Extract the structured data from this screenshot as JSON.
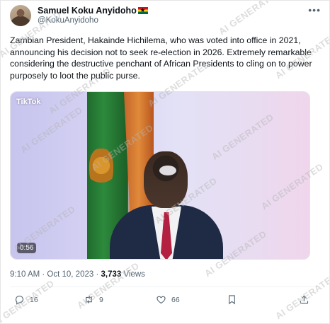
{
  "author": {
    "display_name": "Samuel Koku Anyidoho",
    "handle": "@KokuAnyidoho",
    "flag_icon": "ghana-flag-icon"
  },
  "tweet": {
    "text": "Zambian President, Hakainde Hichilema,  who was voted into office in 2021, announcing his decision not to seek re-election in 2026. Extremely remarkable considering the destructive penchant of African Presidents to cling on to power purposely to loot the public purse."
  },
  "media": {
    "source_logo": "TikTok",
    "duration": "0:56"
  },
  "meta": {
    "time_date": "9:10 AM · Oct 10, 2023 · ",
    "views_count": "3,733",
    "views_label": " Views"
  },
  "actions": {
    "replies": "16",
    "reposts": "9",
    "likes": "66"
  },
  "watermark": {
    "text": "AI GENERATED"
  },
  "colors": {
    "text_primary": "#0f1419",
    "text_secondary": "#536471",
    "flag_green": "#2d8a3c",
    "flag_orange": "#e08a3a"
  }
}
